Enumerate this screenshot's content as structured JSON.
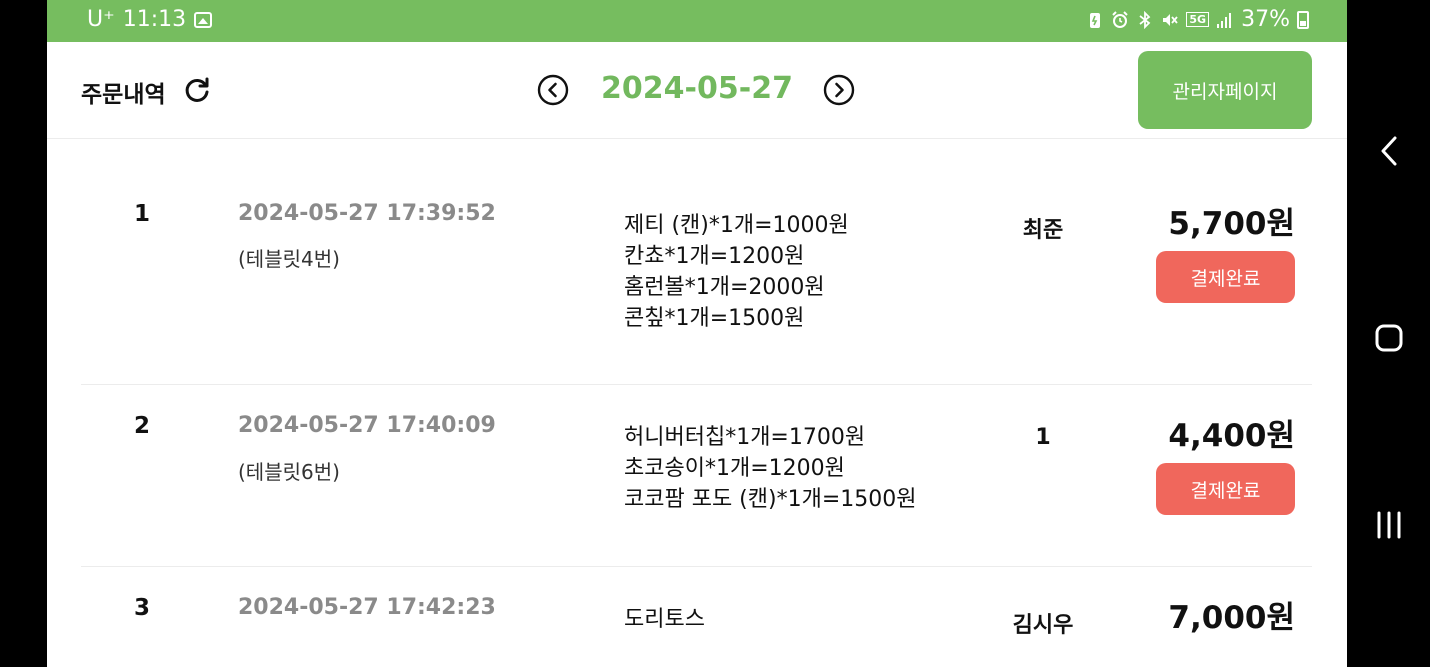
{
  "status_bar": {
    "carrier": "U⁺",
    "time": "11:13",
    "network": "5G",
    "battery": "37%"
  },
  "header": {
    "title": "주문내역",
    "date": "2024-05-27",
    "admin_button": "관리자페이지"
  },
  "orders": [
    {
      "number": "1",
      "time": "2024-05-27 17:39:52",
      "table": "(테블릿4번)",
      "items": [
        "제티 (캔)*1개=1000원",
        "칸쵸*1개=1200원",
        "홈런볼*1개=2000원",
        "콘칲*1개=1500원"
      ],
      "name": "최준",
      "total": "5,700원",
      "pay_button": "결제완료"
    },
    {
      "number": "2",
      "time": "2024-05-27 17:40:09",
      "table": "(테블릿6번)",
      "items": [
        "허니버터칩*1개=1700원",
        "초코송이*1개=1200원",
        "코코팜 포도 (캔)*1개=1500원"
      ],
      "name": "1",
      "total": "4,400원",
      "pay_button": "결제완료"
    },
    {
      "number": "3",
      "time": "2024-05-27 17:42:23",
      "table": "",
      "items": [
        "도리토스"
      ],
      "name": "김시우",
      "total": "7,000원",
      "pay_button": ""
    }
  ],
  "colors": {
    "accent_green": "#76bd5f",
    "pay_red": "#f0675c",
    "time_gray": "#8a8a8a"
  },
  "icons": {
    "refresh": "refresh-icon",
    "prev": "chevron-left-circle-icon",
    "next": "chevron-right-circle-icon"
  }
}
